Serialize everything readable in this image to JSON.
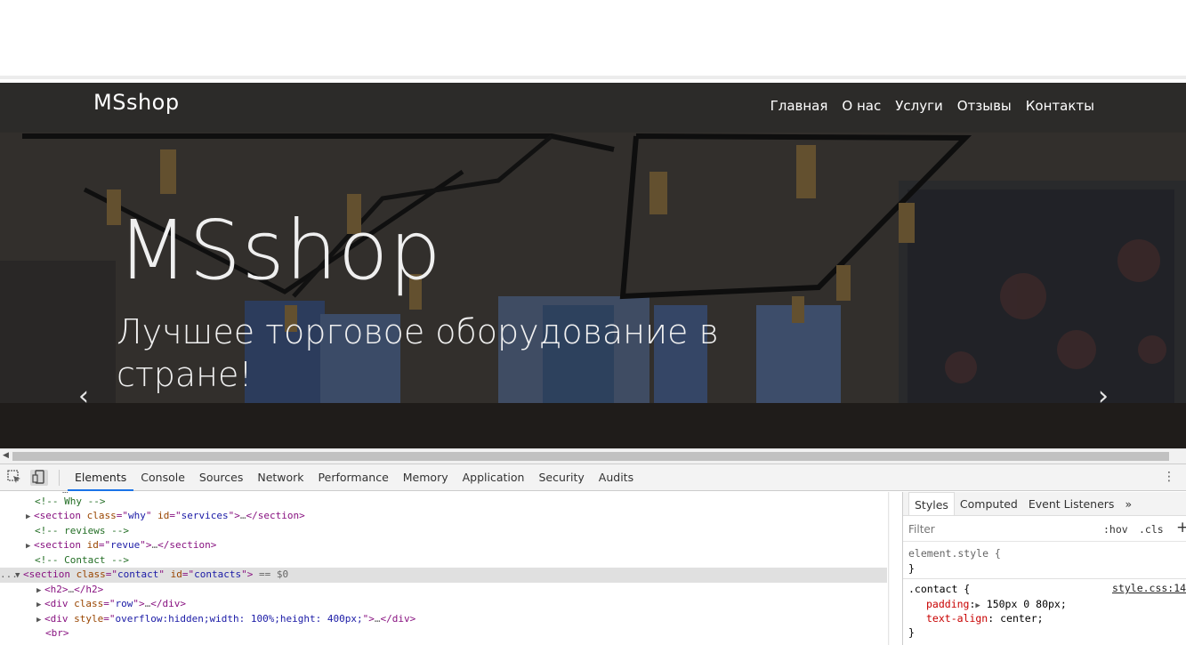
{
  "hero": {
    "brand": "MSshop",
    "nav": [
      "Главная",
      "О нас",
      "Услуги",
      "Отзывы",
      "Контакты"
    ],
    "title": "MSshop",
    "subtitle": "Лучшее торговое оборудование в стране!",
    "prev_icon": "chevron-left-icon",
    "next_icon": "chevron-right-icon",
    "prev_glyph": "‹",
    "next_glyph": "›"
  },
  "devtools": {
    "tabs": [
      "Elements",
      "Console",
      "Sources",
      "Network",
      "Performance",
      "Memory",
      "Application",
      "Security",
      "Audits"
    ],
    "active_tab": "Elements",
    "menu_glyph": "⋮",
    "dom_lines": [
      {
        "indent": 0,
        "toggle": "",
        "parts": [
          [
            "c-comment",
            "<!-- Why -->"
          ]
        ]
      },
      {
        "indent": 0,
        "toggle": "▶",
        "parts": [
          [
            "c-tag",
            "<section "
          ],
          [
            "c-attr",
            "class"
          ],
          [
            "c-tag",
            "=\""
          ],
          [
            "c-val",
            "why"
          ],
          [
            "c-tag",
            "\" "
          ],
          [
            "c-attr",
            "id"
          ],
          [
            "c-tag",
            "=\""
          ],
          [
            "c-val",
            "services"
          ],
          [
            "c-tag",
            "\">"
          ],
          [
            "c-gray",
            "…"
          ],
          [
            "c-tag",
            "</section>"
          ]
        ]
      },
      {
        "indent": 0,
        "toggle": "",
        "parts": [
          [
            "c-comment",
            "<!-- reviews -->"
          ]
        ]
      },
      {
        "indent": 0,
        "toggle": "▶",
        "parts": [
          [
            "c-tag",
            "<section "
          ],
          [
            "c-attr",
            "id"
          ],
          [
            "c-tag",
            "=\""
          ],
          [
            "c-val",
            "revue"
          ],
          [
            "c-tag",
            "\">"
          ],
          [
            "c-gray",
            "…"
          ],
          [
            "c-tag",
            "</section>"
          ]
        ]
      },
      {
        "indent": 0,
        "toggle": "",
        "parts": [
          [
            "c-comment",
            "<!-- Contact -->"
          ]
        ]
      },
      {
        "indent": 0,
        "toggle": "▼",
        "selected": true,
        "parts": [
          [
            "c-tag",
            "<section "
          ],
          [
            "c-attr",
            "class"
          ],
          [
            "c-tag",
            "=\""
          ],
          [
            "c-val",
            "contact"
          ],
          [
            "c-tag",
            "\" "
          ],
          [
            "c-attr",
            "id"
          ],
          [
            "c-tag",
            "=\""
          ],
          [
            "c-val",
            "contacts"
          ],
          [
            "c-tag",
            "\">"
          ],
          [
            "c-gray",
            " == $0"
          ]
        ]
      },
      {
        "indent": 1,
        "toggle": "▶",
        "parts": [
          [
            "c-tag",
            "<h2>"
          ],
          [
            "c-gray",
            "…"
          ],
          [
            "c-tag",
            "</h2>"
          ]
        ]
      },
      {
        "indent": 1,
        "toggle": "▶",
        "parts": [
          [
            "c-tag",
            "<div "
          ],
          [
            "c-attr",
            "class"
          ],
          [
            "c-tag",
            "=\""
          ],
          [
            "c-val",
            "row"
          ],
          [
            "c-tag",
            "\">"
          ],
          [
            "c-gray",
            "…"
          ],
          [
            "c-tag",
            "</div>"
          ]
        ]
      },
      {
        "indent": 1,
        "toggle": "▶",
        "parts": [
          [
            "c-tag",
            "<div "
          ],
          [
            "c-attr",
            "style"
          ],
          [
            "c-tag",
            "=\""
          ],
          [
            "c-val",
            "overflow:hidden;width: 100%;height: 400px;"
          ],
          [
            "c-tag",
            "\">"
          ],
          [
            "c-gray",
            "…"
          ],
          [
            "c-tag",
            "</div>"
          ]
        ]
      },
      {
        "indent": 1,
        "toggle": "",
        "parts": [
          [
            "c-tag",
            "<br>"
          ]
        ]
      }
    ],
    "selected_marker": "...",
    "styles": {
      "tabs": [
        "Styles",
        "Computed",
        "Event Listeners"
      ],
      "more_glyph": "»",
      "filter_placeholder": "Filter",
      "hov": ":hov",
      "cls": ".cls",
      "add_glyph": "+",
      "element_style_selector": "element.style {",
      "close_brace": "}",
      "contact_selector": ".contact {",
      "contact_source": "style.css:14",
      "prop_padding": "padding",
      "val_padding": "150px 0 80px;",
      "prop_align": "text-align",
      "val_align": "center;"
    }
  },
  "colors": {
    "tab_accent": "#1a73e8",
    "dom_tag": "#881280",
    "dom_attr": "#994500",
    "dom_value": "#1a1aa6",
    "dom_comment": "#236e25"
  }
}
